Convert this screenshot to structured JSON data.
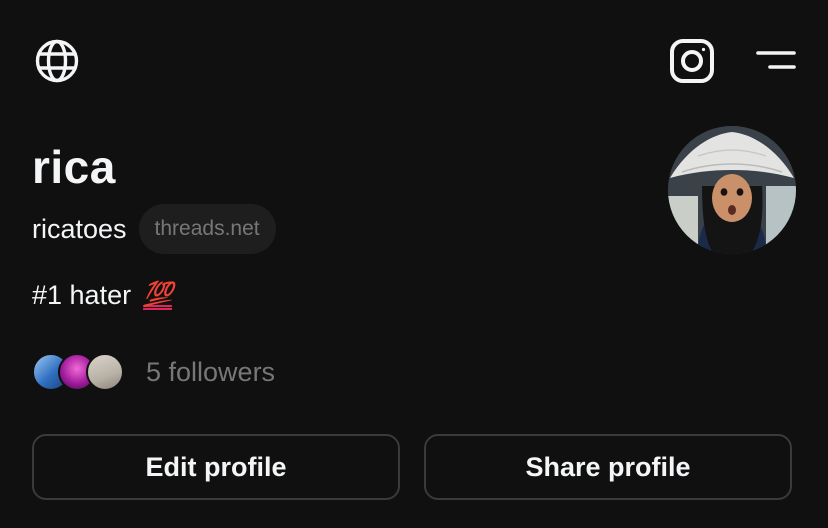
{
  "header": {
    "language_icon": "globe-icon",
    "instagram_icon": "instagram-icon",
    "menu_icon": "menu-icon"
  },
  "profile": {
    "display_name": "rica",
    "username": "ricatoes",
    "domain_chip": "threads.net",
    "bio_text": "#1 hater",
    "bio_emoji": "💯",
    "followers_text": "5 followers"
  },
  "actions": {
    "edit_label": "Edit profile",
    "share_label": "Share profile"
  },
  "colors": {
    "background": "#101010",
    "primary_text": "#f3f5f7",
    "secondary_text": "#777777",
    "chip_background": "#1e1e1e",
    "button_border": "#3a3a3a"
  }
}
